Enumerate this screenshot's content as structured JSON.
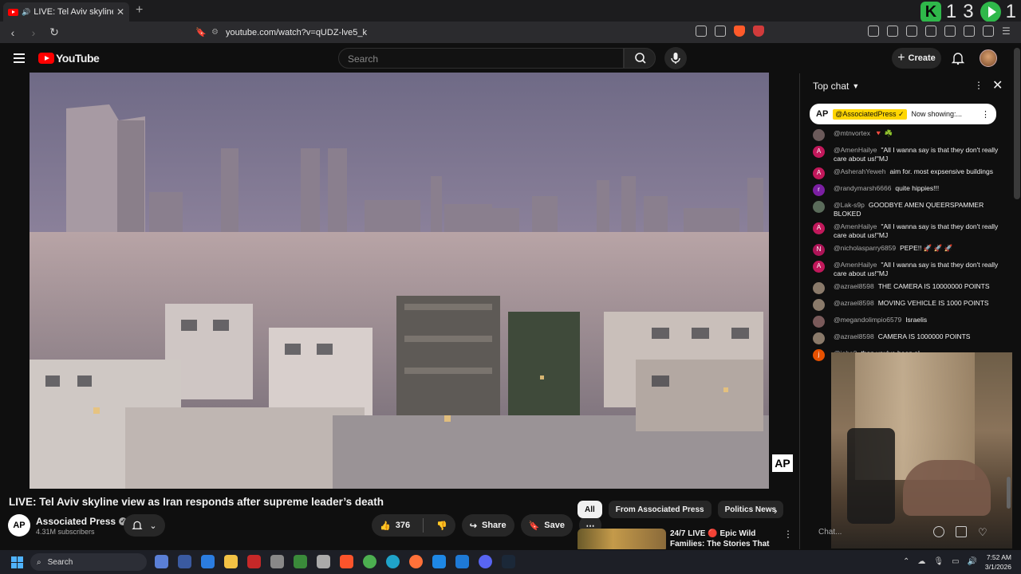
{
  "browser": {
    "tab_title": "LIVE: Tel Aviv skyline view as Iran responds after supreme leader's death",
    "new_tab_label": "+",
    "url": "youtube.com/watch?v=qUDZ-lve5_k",
    "overlay_counter_left": "1",
    "overlay_counter_right": "3",
    "overlay_counter_extra": "1"
  },
  "header": {
    "logo_text": "YouTube",
    "search_placeholder": "Search",
    "create_label": "Create"
  },
  "video": {
    "title": "LIVE: Tel Aviv skyline view as Iran responds after supreme leader’s death",
    "watermark": "AP",
    "channel_name": "Associated Press",
    "channel_avatar": "AP",
    "subscribers": "4.31M subscribers",
    "like_count": "376",
    "share_label": "Share",
    "save_label": "Save"
  },
  "sidebar": {
    "chips": [
      "All",
      "From Associated Press",
      "Politics News"
    ],
    "recommendation_title": "24/7 LIVE 🔴 Epic Wild Families: The Stories That ..."
  },
  "chat": {
    "title": "Top chat",
    "pinned_avatar": "AP",
    "pinned_author": "@AssociatedPress ✓",
    "pinned_text": "Now showing:...",
    "input_placeholder": "Chat...",
    "messages": [
      {
        "author": "@mtnvortex",
        "text": "🔻 ☘️",
        "avatar": "",
        "color": "#6b5a5a"
      },
      {
        "author": "@AmenHailye",
        "text": "\"All I wanna say is that they don't really care about us!\"MJ",
        "avatar": "A",
        "color": "#c2185b"
      },
      {
        "author": "@AsherahYeweh",
        "text": "aim for. most expsensive buildings",
        "avatar": "A",
        "color": "#c2185b"
      },
      {
        "author": "@randymarsh6666",
        "text": "quite hippies!!!",
        "avatar": "r",
        "color": "#7b1fa2"
      },
      {
        "author": "@Lak-s9p",
        "text": "GOODBYE AMEN QUEERSPAMMER BLOKED",
        "avatar": "",
        "color": "#5a6b5a"
      },
      {
        "author": "@AmenHailye",
        "text": "\"All I wanna say is that they don't really care about us!\"MJ",
        "avatar": "A",
        "color": "#c2185b"
      },
      {
        "author": "@nicholasparry6859",
        "text": "PEPE!! 🚀 🚀 🚀",
        "avatar": "N",
        "color": "#ad1457"
      },
      {
        "author": "@AmenHailye",
        "text": "\"All I wanna say is that they don't really care about us!\"MJ",
        "avatar": "A",
        "color": "#c2185b"
      },
      {
        "author": "@azrael8598",
        "text": "THE CAMERA IS 10000000 POINTS",
        "avatar": "",
        "color": "#8a7a6a"
      },
      {
        "author": "@azrael8598",
        "text": "MOVING VEHICLE IS 1000 POINTS",
        "avatar": "",
        "color": "#8a7a6a"
      },
      {
        "author": "@megandolimpio6579",
        "text": "Israelis",
        "avatar": "",
        "color": "#7a5a5a"
      },
      {
        "author": "@azrael8598",
        "text": "CAMERA IS 1000000 POINTS",
        "avatar": "",
        "color": "#8a7a6a"
      },
      {
        "author": "@joho0",
        "text": "than you've been al",
        "avatar": "j",
        "color": "#e65100"
      }
    ]
  },
  "taskbar": {
    "search_label": "Search",
    "time": "7:52 AM",
    "date": "3/1/2026"
  },
  "colors": {
    "yt_red": "#ff0000",
    "pinned_highlight": "#ffd600",
    "game_green": "#2fb84a"
  }
}
